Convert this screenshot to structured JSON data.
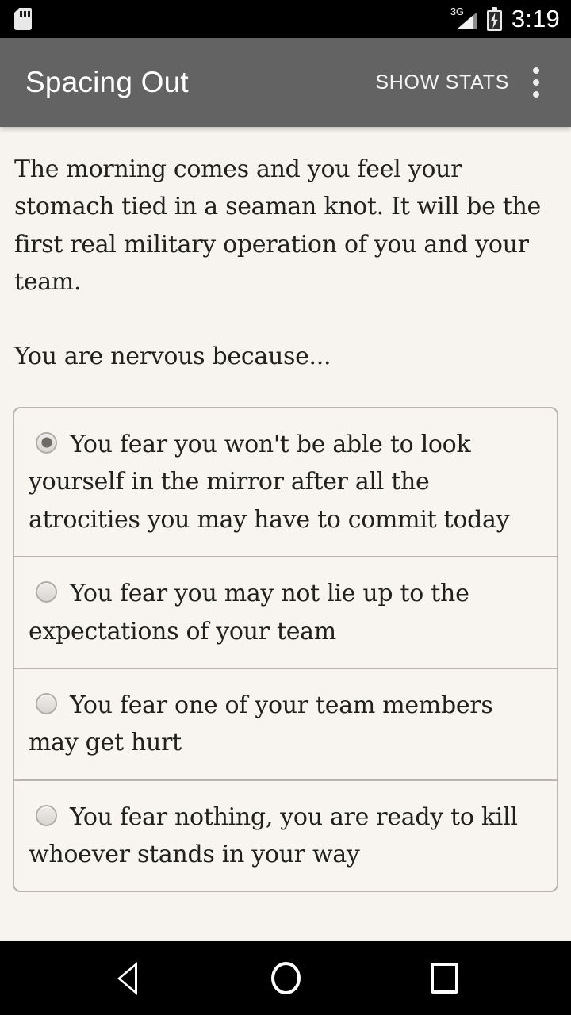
{
  "status_bar": {
    "sd_card_icon": "sd-card-icon",
    "network_label": "3G",
    "signal_icon": "signal-bars-icon",
    "battery_icon": "battery-charging-icon",
    "time": "3:19"
  },
  "action_bar": {
    "title": "Spacing Out",
    "show_stats_label": "SHOW STATS",
    "overflow_icon": "overflow-menu-icon",
    "background_color": "#636363"
  },
  "story": {
    "paragraph_1": "The morning comes and you feel your stomach tied in a seaman knot. It will be the first real military operation of you and your team.",
    "paragraph_2": "You are nervous because..."
  },
  "options": [
    {
      "label": "You fear you won't be able to look yourself in the mirror after all the atrocities you may have to commit today",
      "selected": true
    },
    {
      "label": "You fear you may not lie up to the expectations of your team",
      "selected": false
    },
    {
      "label": "You fear one of your team members may get hurt",
      "selected": false
    },
    {
      "label": "You fear nothing, you are ready to kill whoever stands in your way",
      "selected": false
    }
  ],
  "nav_bar": {
    "back_icon": "back-triangle-icon",
    "home_icon": "home-circle-icon",
    "recents_icon": "recents-square-icon"
  },
  "theme": {
    "page_background": "#f7f4ef",
    "card_background": "#f8f5f0",
    "border_color": "#b9b5ae",
    "text_color": "#20201e"
  }
}
